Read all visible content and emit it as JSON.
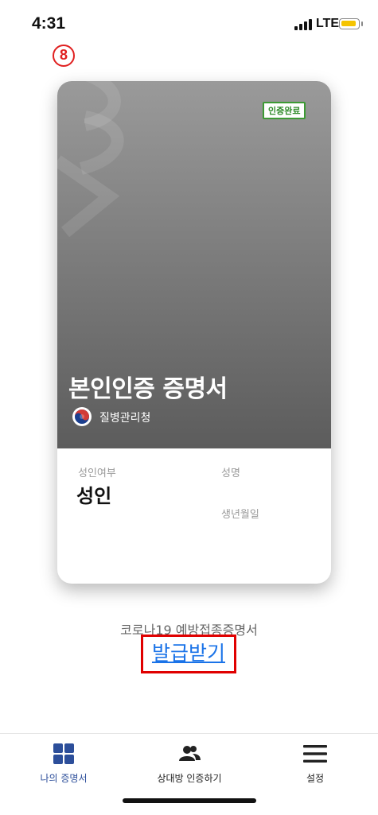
{
  "status_bar": {
    "time": "4:31",
    "network": "LTE",
    "battery_color": "#f5c400"
  },
  "step_marker": "8",
  "card": {
    "badge": "인증완료",
    "title": "본인인증 증명서",
    "agency": "질병관리청",
    "fields": {
      "adult_label": "성인여부",
      "adult_value": "성인",
      "name_label": "성명",
      "birth_label": "생년월일"
    }
  },
  "covid": {
    "label": "코로나19 예방접종증명서",
    "link": "발급받기"
  },
  "nav": {
    "items": [
      {
        "label": "나의 증명서",
        "icon": "grid-icon",
        "active": true
      },
      {
        "label": "상대방 인증하기",
        "icon": "people-icon",
        "active": false
      },
      {
        "label": "설정",
        "icon": "menu-icon",
        "active": false
      }
    ]
  },
  "colors": {
    "accent": "#2c4e9a",
    "link": "#1a73e8",
    "highlight": "#e00000",
    "badge_green": "#3d9a34"
  }
}
